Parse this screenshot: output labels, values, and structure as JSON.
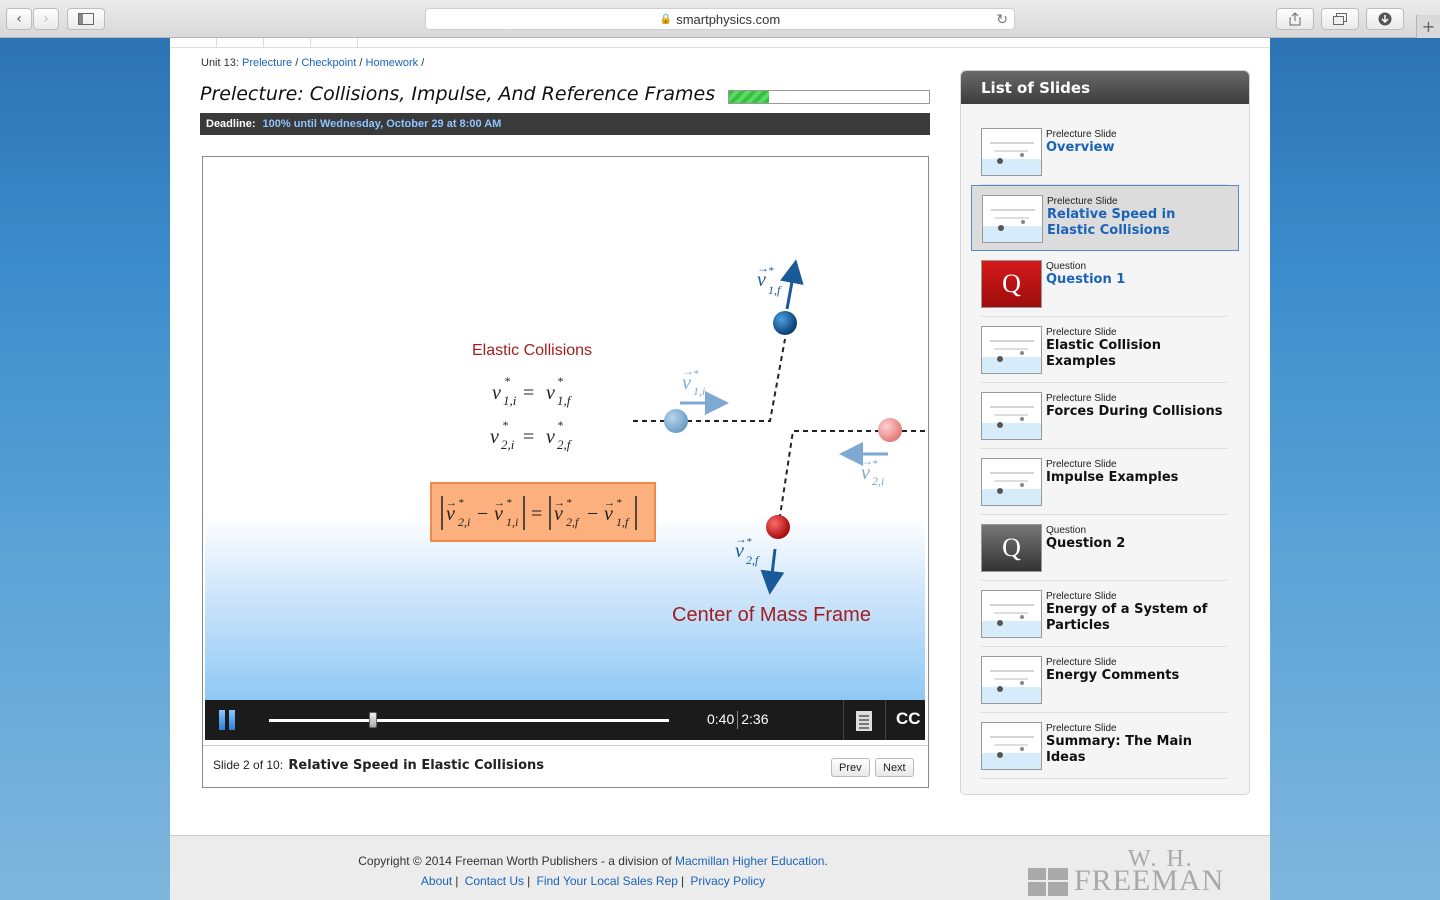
{
  "browser": {
    "url": "smartphysics.com"
  },
  "breadcrumb": {
    "unit": "Unit 13:",
    "links": [
      "Prelecture",
      "Checkpoint",
      "Homework"
    ],
    "sep": "/"
  },
  "header": {
    "title": "Prelecture: Collisions, Impulse, And Reference Frames",
    "progress": 0.2,
    "deadline_label": "Deadline:",
    "deadline_value": "100% until Wednesday, October 29 at 8:00 AM"
  },
  "slide": {
    "elastic_title": "Elastic Collisions",
    "frame_label": "Center of Mass Frame"
  },
  "player": {
    "elapsed": "0:40",
    "duration": "2:36",
    "position": 0.26,
    "cc_label": "CC"
  },
  "caption": {
    "slide_number": "Slide 2 of 10:",
    "slide_title": "Relative Speed in Elastic Collisions",
    "prev": "Prev",
    "next": "Next"
  },
  "sidebar": {
    "title": "List of Slides",
    "items": [
      {
        "kind": "Prelecture Slide",
        "name": "Overview",
        "thumb": "slide"
      },
      {
        "kind": "Prelecture Slide",
        "name": "Relative Speed in Elastic Collisions",
        "thumb": "slide",
        "active": true
      },
      {
        "kind": "Question",
        "name": "Question 1",
        "thumb": "question-red"
      },
      {
        "kind": "Prelecture Slide",
        "name": "Elastic Collision Examples",
        "thumb": "slide"
      },
      {
        "kind": "Prelecture Slide",
        "name": "Forces During Collisions",
        "thumb": "slide"
      },
      {
        "kind": "Prelecture Slide",
        "name": "Impulse Examples",
        "thumb": "slide"
      },
      {
        "kind": "Question",
        "name": "Question 2",
        "thumb": "question-gray"
      },
      {
        "kind": "Prelecture Slide",
        "name": "Energy of a System of Particles",
        "thumb": "slide"
      },
      {
        "kind": "Prelecture Slide",
        "name": "Energy Comments",
        "thumb": "slide"
      },
      {
        "kind": "Prelecture Slide",
        "name": "Summary: The Main Ideas",
        "thumb": "slide"
      }
    ]
  },
  "footer": {
    "copyright": "Copyright © 2014 Freeman Worth Publishers - a division of",
    "copyright_link": "Macmillan Higher Education",
    "links": [
      "About",
      "Contact Us",
      "Find Your Local Sales Rep",
      "Privacy Policy"
    ],
    "logo_line1": "W. H.",
    "logo_line2": "FREEMAN"
  },
  "colors": {
    "accent": "#1a63b8",
    "slide_red": "#a41d1d",
    "progress_green": "#37c142"
  }
}
